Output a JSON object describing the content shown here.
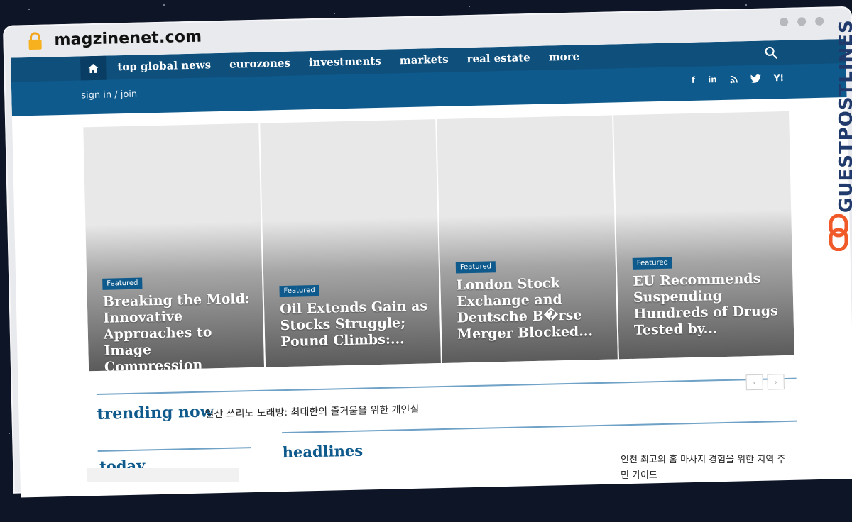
{
  "browser": {
    "url": "magzinenet.com",
    "window_dots": 3
  },
  "nav": {
    "home_icon": "home-icon",
    "menu": [
      "top global news",
      "eurozones",
      "investments",
      "markets",
      "real estate",
      "more"
    ],
    "signin": "sign in / join",
    "social": [
      "f",
      "in",
      "rss",
      "twitter",
      "Y!"
    ]
  },
  "slides": [
    {
      "badge": "Featured",
      "title": "Breaking the Mold: Innovative Approaches to Image Compression"
    },
    {
      "badge": "Featured",
      "title": "Oil Extends Gain as Stocks Struggle; Pound Climbs:..."
    },
    {
      "badge": "Featured",
      "title": "London Stock Exchange and Deutsche B�rse Merger Blocked..."
    },
    {
      "badge": "Featured",
      "title": "EU Recommends Suspending Hundreds of Drugs Tested by..."
    }
  ],
  "trending": {
    "label": "trending now",
    "text": "일산 쓰리노 노래방: 최대한의 즐거움을 위한 개인실",
    "prev": "‹",
    "next": "›"
  },
  "sections": {
    "today": "today",
    "headlines": "headlines",
    "headlines_side": "인천 최고의 홈 마사지 경험을 위한 지역 주민 가이드"
  },
  "watermark": "GUESTPOSTLINES",
  "colors": {
    "nav_bg": "#0f5a8c",
    "accent": "#0f5a8c",
    "brand": "#1f3a6b",
    "brand_icon": "#f05a28"
  }
}
